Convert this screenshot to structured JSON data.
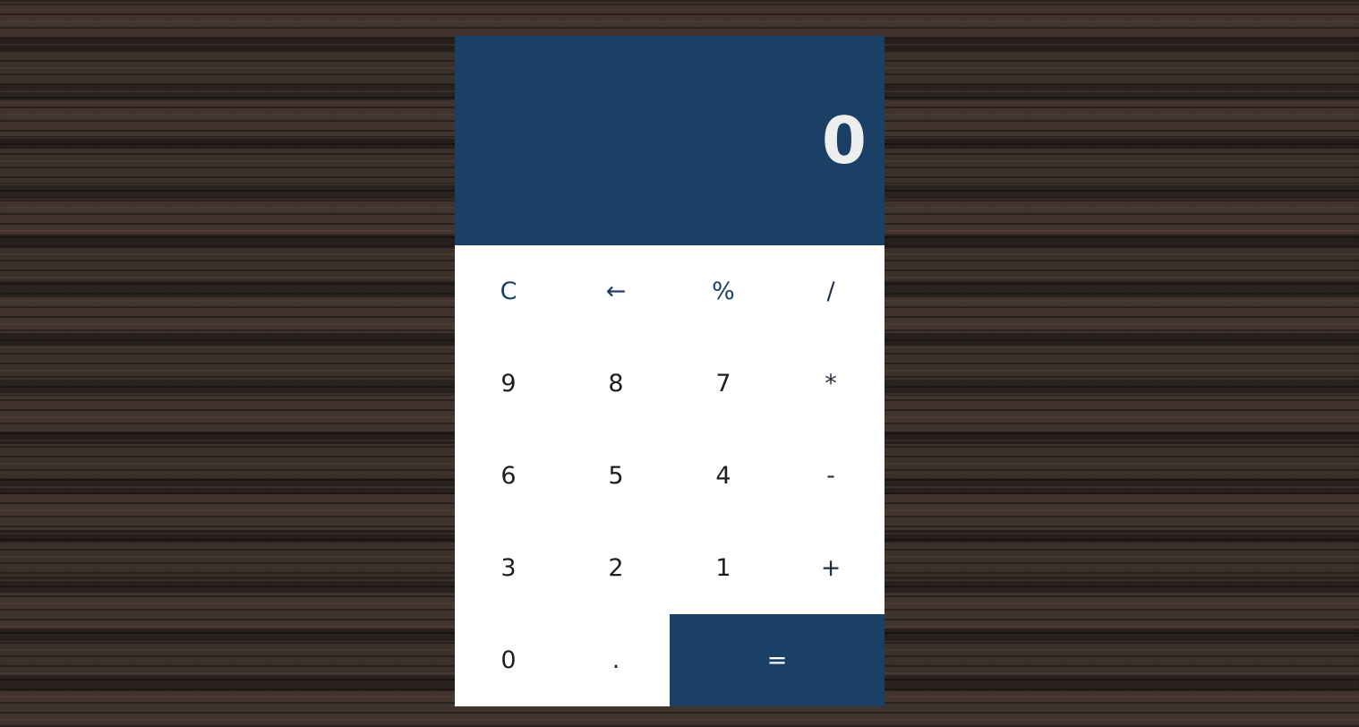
{
  "display": {
    "value": "0"
  },
  "keys": {
    "clear": "C",
    "backspace": "←",
    "percent": "%",
    "divide": "/",
    "nine": "9",
    "eight": "8",
    "seven": "7",
    "multiply": "*",
    "six": "6",
    "five": "5",
    "four": "4",
    "subtract": "-",
    "three": "3",
    "two": "2",
    "one": "1",
    "add": "+",
    "zero": "0",
    "decimal": ".",
    "equals": "="
  },
  "colors": {
    "accent": "#1b4066",
    "display_text": "#eeeeee",
    "keypad_background": "#ffffff"
  }
}
